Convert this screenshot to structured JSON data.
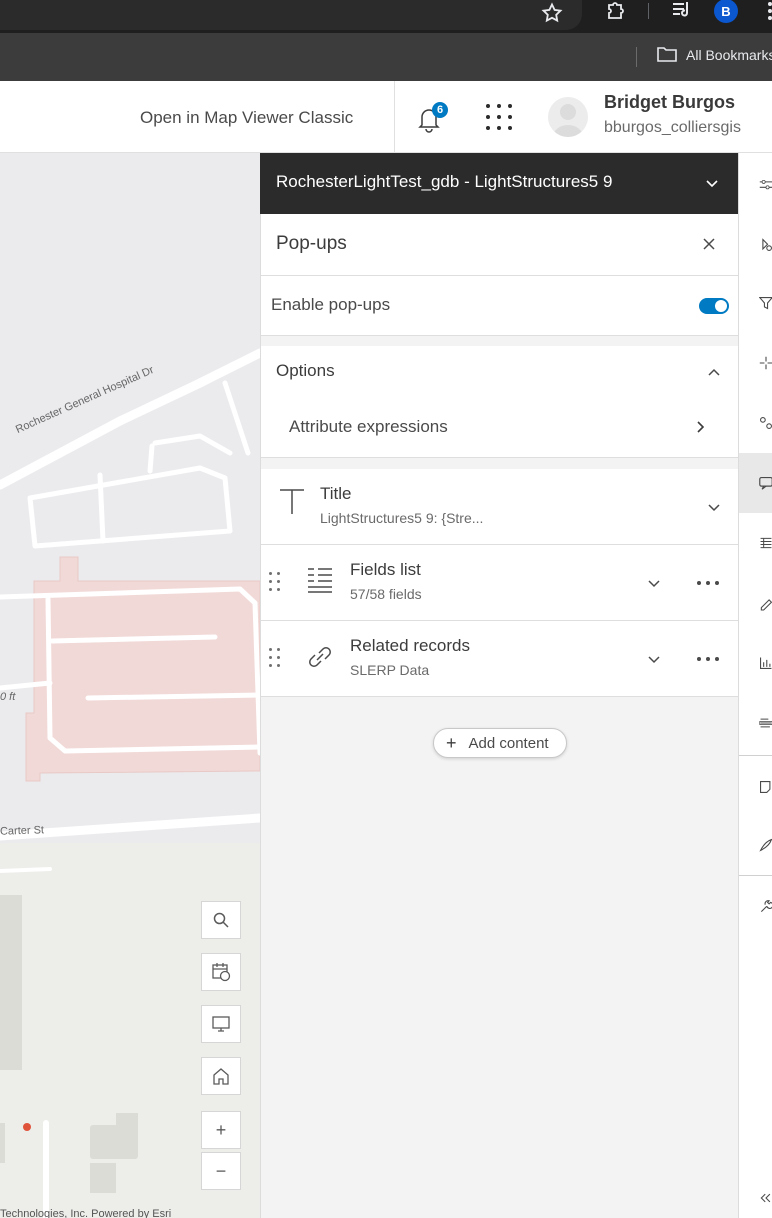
{
  "browser": {
    "bookmarks_label": "All Bookmarks",
    "profile_initial": "B"
  },
  "header": {
    "open_classic_link": "Open in Map Viewer Classic",
    "notification_count": "6",
    "user_name": "Bridget Burgos",
    "user_id": "bburgos_colliersgis"
  },
  "map": {
    "streets": [
      "Rochester General Hospital Dr",
      "Carter St"
    ],
    "scale_text": "0 ft",
    "attribution": "Technologies, Inc.    Powered by Esri",
    "tools": [
      "search-icon",
      "calendar-globe-icon",
      "monitor-icon",
      "home-icon",
      "zoom-in",
      "zoom-out"
    ],
    "zoom_in_label": "+",
    "zoom_out_label": "−"
  },
  "layer": {
    "title": "RochesterLightTest_gdb - LightStructures5 9"
  },
  "panel": {
    "title": "Pop-ups",
    "enable_label": "Enable pop-ups",
    "enable_on": true,
    "options_label": "Options",
    "attr_expressions_label": "Attribute expressions",
    "cards": [
      {
        "title": "Title",
        "subtitle": "LightStructures5 9: {Stre...",
        "icon": "text-icon"
      },
      {
        "title": "Fields list",
        "subtitle": "57/58 fields",
        "icon": "fields-list-icon"
      },
      {
        "title": "Related records",
        "subtitle": "SLERP Data",
        "icon": "link-icon"
      }
    ],
    "add_content_label": "Add content"
  },
  "colors": {
    "accent": "#007ac2",
    "layer_header_bg": "#2b2b2b",
    "map_bg": "#ebebee",
    "hospital_fill": "#f1d9d7"
  }
}
